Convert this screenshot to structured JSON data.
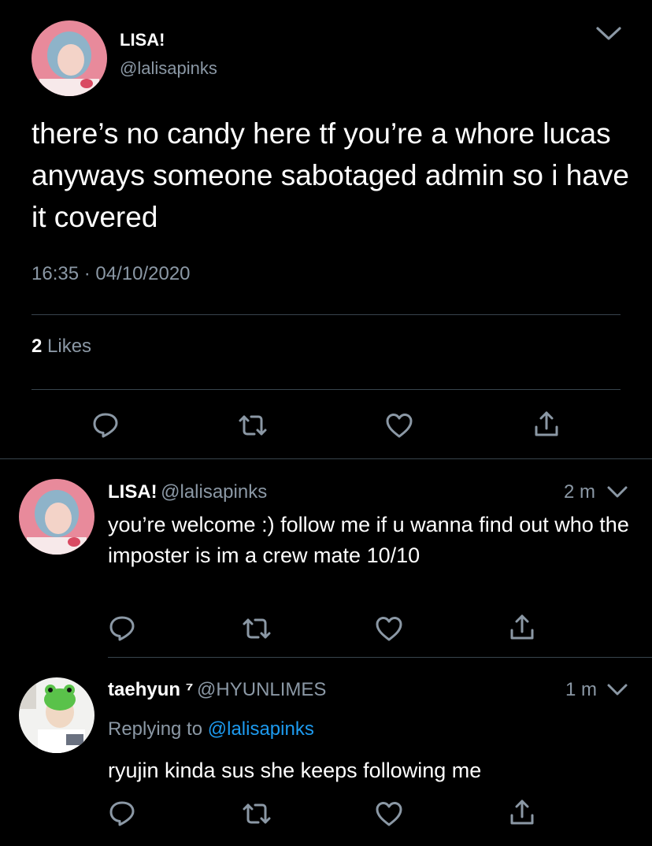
{
  "main_tweet": {
    "name": "LISA!",
    "handle": "@lalisapinks",
    "text": "there’s no candy here tf you’re a whore lucas anyways someone sabotaged admin so i have it covered",
    "time": "16:35",
    "separator": "·",
    "date": "04/10/2020",
    "likes_count": "2",
    "likes_label": "Likes"
  },
  "replies": [
    {
      "name": "LISA!",
      "handle": "@lalisapinks",
      "time_ago": "2 m",
      "text": "you’re welcome :) follow me if u wanna find out who the imposter is im a crew mate 10/10"
    },
    {
      "name": "taehyun ⁷",
      "handle": "@HYUNLIMES",
      "time_ago": "1 m",
      "replying_prefix": "Replying to",
      "replying_to": "@lalisapinks",
      "text": "ryujin kinda sus she keeps following me"
    }
  ],
  "colors": {
    "background": "#000000",
    "text": "#ffffff",
    "muted": "#8b98a5",
    "link": "#1d9bf0",
    "divider": "#38444d"
  },
  "icons": [
    "chevron-down-icon",
    "reply-icon",
    "retweet-icon",
    "like-icon",
    "share-icon"
  ]
}
